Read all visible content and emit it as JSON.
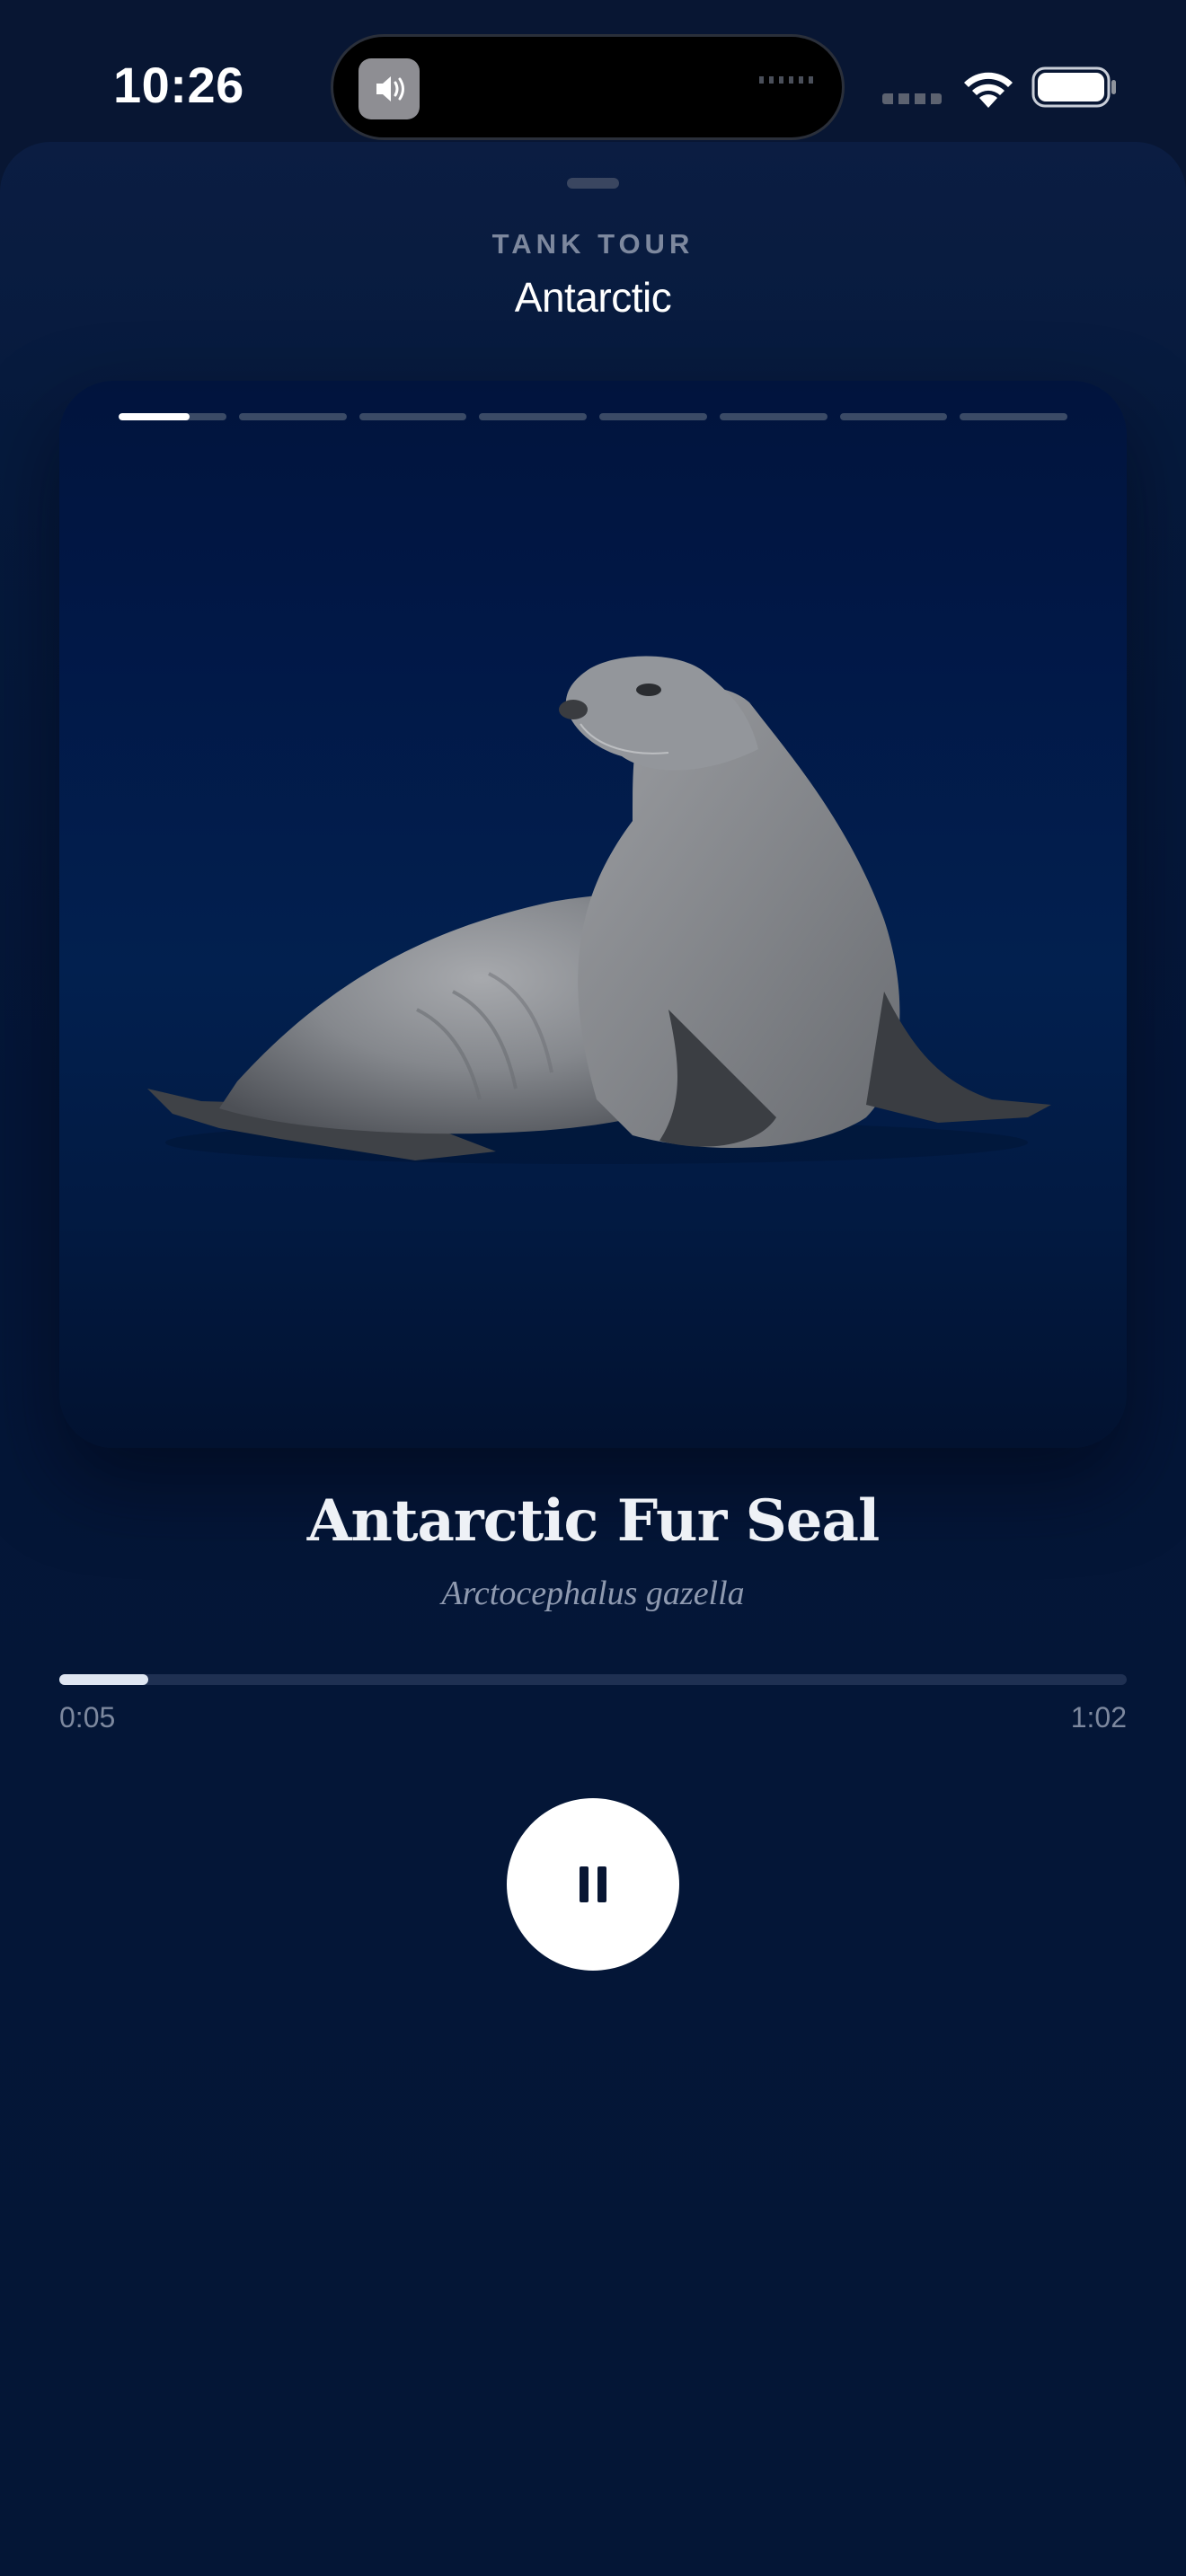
{
  "status_bar": {
    "time": "10:26",
    "icons": [
      "speaker-icon",
      "wifi-icon",
      "battery-icon"
    ]
  },
  "header": {
    "eyebrow": "TANK TOUR",
    "title": "Antarctic"
  },
  "story": {
    "segments_total": 8,
    "current_segment": 1,
    "current_segment_progress": 0.66,
    "image": "fur-seal-photo"
  },
  "species": {
    "common_name": "Antarctic Fur Seal",
    "scientific_name": "Arctocephalus gazella"
  },
  "playback": {
    "elapsed": "0:05",
    "total": "1:02",
    "progress": 0.083,
    "state": "playing",
    "control_icon": "pause-icon"
  },
  "colors": {
    "background": "#081633",
    "card": "#02204f",
    "accent": "#ffffff",
    "muted_text": "#7d889e"
  }
}
